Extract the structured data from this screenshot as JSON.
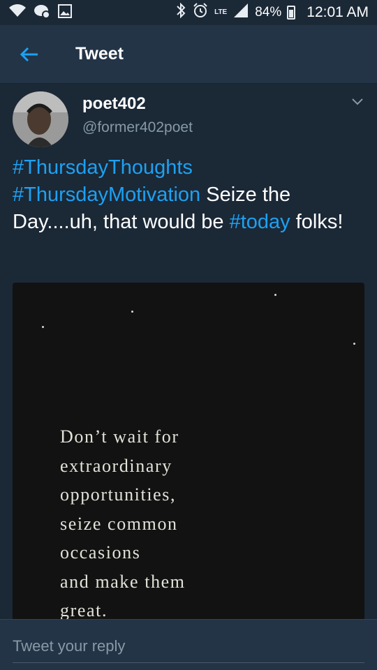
{
  "statusbar": {
    "network_type": "LTE",
    "battery": "84%",
    "time": "12:01 AM",
    "icons": [
      "wifi-icon",
      "notification-icon",
      "image-icon",
      "bluetooth-icon",
      "alarm-icon",
      "lte-icon",
      "signal-icon",
      "battery-icon"
    ]
  },
  "appbar": {
    "title": "Tweet",
    "back_icon": "arrow-left-icon"
  },
  "tweet": {
    "display_name": "poet402",
    "handle": "@former402poet",
    "text_parts": [
      {
        "text": "#ThursdayThoughts",
        "type": "hashtag"
      },
      {
        "text": " ",
        "type": "text"
      },
      {
        "text": "#ThursdayMotivation",
        "type": "hashtag"
      },
      {
        "text": " Seize the Day....uh, that would be ",
        "type": "text"
      },
      {
        "text": "#today",
        "type": "hashtag"
      },
      {
        "text": " folks!",
        "type": "text"
      }
    ],
    "image_quote_lines": [
      "Don’t wait for",
      "extraordinary",
      "opportunities,",
      "seize common",
      "occasions",
      "and make them",
      "great."
    ]
  },
  "reply": {
    "placeholder": "Tweet your reply",
    "value": ""
  },
  "colors": {
    "background": "#1b2836",
    "bar": "#243447",
    "link": "#1da1f2",
    "secondary_text": "#8899a6"
  }
}
